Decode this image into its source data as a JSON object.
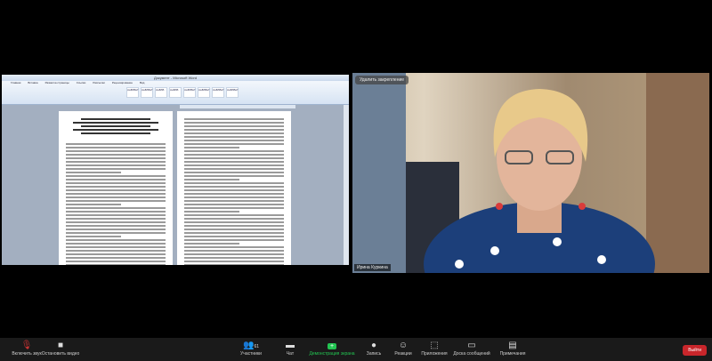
{
  "share": {
    "window_title": "Документ - Microsoft Word",
    "ribbon_tabs": [
      "Главная",
      "Вставка",
      "Разметка страницы",
      "Ссылки",
      "Рассылки",
      "Рецензирование",
      "Вид"
    ],
    "style_gallery": [
      "АаБбВвГ",
      "АаБбВвГ",
      "АаБбВ",
      "АаБбВ",
      "АаБбВвГ",
      "АаБбВвГ",
      "АаБбВвГ",
      "АаБбВвГ"
    ]
  },
  "video": {
    "pin_label": "Удалить закрепление",
    "participant_name": "Ирина Куркина"
  },
  "toolbar": {
    "unmute": "Включить звук",
    "stop_video": "Остановить видео",
    "participants": "Участники",
    "participants_count": "61",
    "chat": "Чат",
    "share": "Демонстрация экрана",
    "record": "Запись",
    "reactions": "Реакции",
    "apps": "Приложения",
    "whiteboard": "Доска сообщений",
    "notes": "Примечания",
    "leave": "Выйти"
  }
}
